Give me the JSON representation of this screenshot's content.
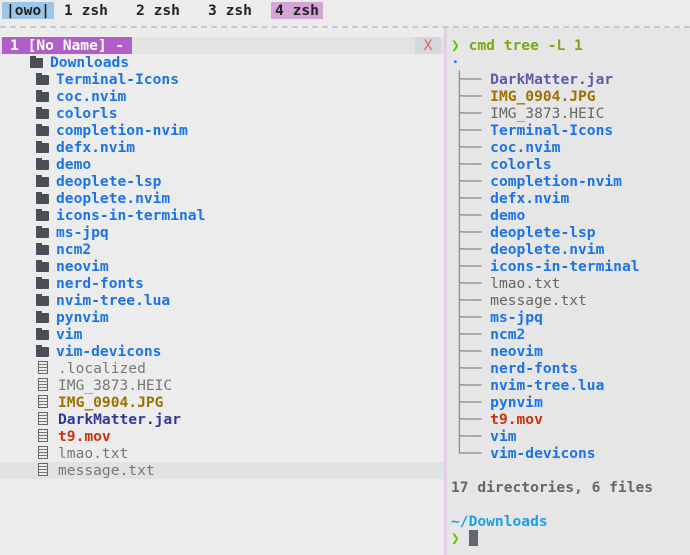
{
  "tabs": [
    {
      "label": "|owo|",
      "bg": "#9cc6e8"
    },
    {
      "label": "1 zsh"
    },
    {
      "label": "2 zsh"
    },
    {
      "label": "3 zsh"
    },
    {
      "label": "4 zsh",
      "bg": "#d4a5d4"
    }
  ],
  "buffer": {
    "name": "1 [No Name] -",
    "close": "X"
  },
  "tree": {
    "root": "Downloads",
    "items": [
      {
        "name": "Terminal-Icons",
        "type": "dir",
        "color": "#1a74e8"
      },
      {
        "name": "coc.nvim",
        "type": "dir",
        "color": "#1a74e8"
      },
      {
        "name": "colorls",
        "type": "dir",
        "color": "#1a74e8"
      },
      {
        "name": "completion-nvim",
        "type": "dir",
        "color": "#1a74e8"
      },
      {
        "name": "defx.nvim",
        "type": "dir",
        "color": "#1a74e8"
      },
      {
        "name": "demo",
        "type": "dir",
        "color": "#1a74e8"
      },
      {
        "name": "deoplete-lsp",
        "type": "dir",
        "color": "#1a74e8"
      },
      {
        "name": "deoplete.nvim",
        "type": "dir",
        "color": "#1a74e8"
      },
      {
        "name": "icons-in-terminal",
        "type": "dir",
        "color": "#1a74e8"
      },
      {
        "name": "ms-jpq",
        "type": "dir",
        "color": "#1a74e8"
      },
      {
        "name": "ncm2",
        "type": "dir",
        "color": "#1a74e8"
      },
      {
        "name": "neovim",
        "type": "dir",
        "color": "#1a74e8"
      },
      {
        "name": "nerd-fonts",
        "type": "dir",
        "color": "#1a74e8"
      },
      {
        "name": "nvim-tree.lua",
        "type": "dir",
        "color": "#1a74e8"
      },
      {
        "name": "pynvim",
        "type": "dir",
        "color": "#1a74e8"
      },
      {
        "name": "vim",
        "type": "dir",
        "color": "#1a74e8"
      },
      {
        "name": "vim-devicons",
        "type": "dir",
        "color": "#1a74e8"
      },
      {
        "name": ".localized",
        "type": "file",
        "color": "#777777"
      },
      {
        "name": "IMG_3873.HEIC",
        "type": "file",
        "color": "#777777"
      },
      {
        "name": "IMG_0904.JPG",
        "type": "file",
        "color": "#a07000"
      },
      {
        "name": "DarkMatter.jar",
        "type": "file",
        "color": "#2e3a9a"
      },
      {
        "name": "t9.mov",
        "type": "file",
        "color": "#d03010"
      },
      {
        "name": "lmao.txt",
        "type": "file",
        "color": "#777777"
      },
      {
        "name": "message.txt",
        "type": "file",
        "color": "#777777",
        "selected": true
      }
    ]
  },
  "terminal": {
    "prompt_symbol": "❯",
    "command": "cmd tree -L 1",
    "dot": ".",
    "entries": [
      {
        "name": "DarkMatter.jar",
        "color": "#5a5aaa"
      },
      {
        "name": "IMG_0904.JPG",
        "color": "#a07000"
      },
      {
        "name": "IMG_3873.HEIC",
        "color": "#666666"
      },
      {
        "name": "Terminal-Icons",
        "color": "#1a74e8"
      },
      {
        "name": "coc.nvim",
        "color": "#1a74e8"
      },
      {
        "name": "colorls",
        "color": "#1a74e8"
      },
      {
        "name": "completion-nvim",
        "color": "#1a74e8"
      },
      {
        "name": "defx.nvim",
        "color": "#1a74e8"
      },
      {
        "name": "demo",
        "color": "#1a74e8"
      },
      {
        "name": "deoplete-lsp",
        "color": "#1a74e8"
      },
      {
        "name": "deoplete.nvim",
        "color": "#1a74e8"
      },
      {
        "name": "icons-in-terminal",
        "color": "#1a74e8"
      },
      {
        "name": "lmao.txt",
        "color": "#666666"
      },
      {
        "name": "message.txt",
        "color": "#666666"
      },
      {
        "name": "ms-jpq",
        "color": "#1a74e8"
      },
      {
        "name": "ncm2",
        "color": "#1a74e8"
      },
      {
        "name": "neovim",
        "color": "#1a74e8"
      },
      {
        "name": "nerd-fonts",
        "color": "#1a74e8"
      },
      {
        "name": "nvim-tree.lua",
        "color": "#1a74e8"
      },
      {
        "name": "pynvim",
        "color": "#1a74e8"
      },
      {
        "name": "t9.mov",
        "color": "#d03010"
      },
      {
        "name": "vim",
        "color": "#1a74e8"
      },
      {
        "name": "vim-devicons",
        "color": "#1a74e8"
      }
    ],
    "summary": "17 directories, 6 files",
    "cwd": "~/Downloads"
  }
}
